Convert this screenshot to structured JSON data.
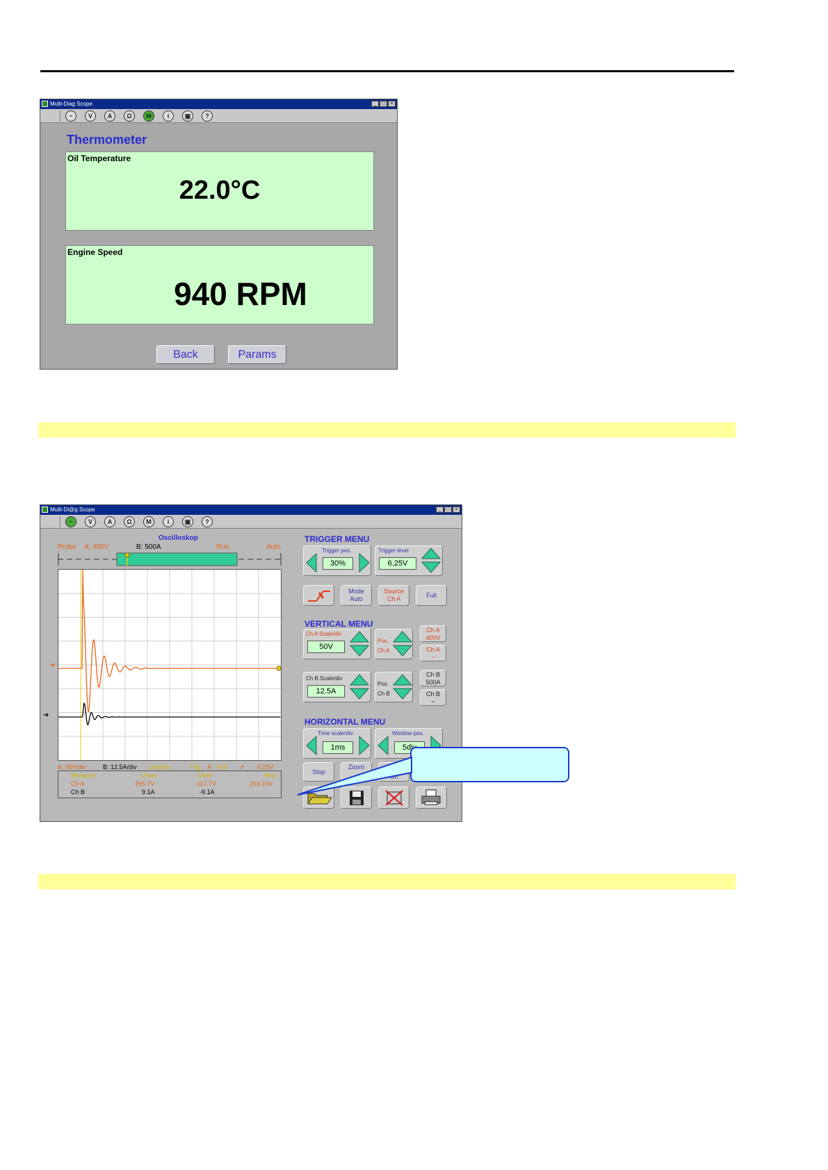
{
  "thermo_window": {
    "title": "Multi-Diag Scope",
    "heading": "Thermometer",
    "oil": {
      "label": "Oil Temperature",
      "value": "22.0°C"
    },
    "rpm": {
      "label": "Engine Speed",
      "value": "940 RPM"
    },
    "back_label": "Back",
    "params_label": "Params"
  },
  "scope_window": {
    "title": "Multi-Di@g Scope",
    "osc_label": "Oscilloskop",
    "probe_label": "Probe",
    "probe_a": "A: 400V",
    "probe_b": "B: 500A",
    "run_label": "Run",
    "auto_label": "Auto",
    "trigger_menu": "TRIGGER MENU",
    "trigger_pos_label": "Trigger pos.",
    "trigger_pos_value": "30%",
    "trigger_level_label": "Trigger level",
    "trigger_level_value": "6.25V",
    "mode_label": "Mode",
    "mode_value": "Auto",
    "source_label": "Source",
    "source_value": "Ch A",
    "full_label": "Full",
    "vertical_menu": "VERTICAL MENU",
    "cha_scale_label": "Ch A Scale/div",
    "cha_scale_value": "50V",
    "pos_label": "Pos.",
    "cha_label": "Ch A",
    "cha_400v": "400V",
    "cha_ac": "~",
    "chb_scale_label": "Ch B Scale/div",
    "chb_scale_value": "12.5A",
    "chb_label": "Ch B",
    "chb_500a": "500A",
    "chb_ac": "~",
    "horizontal_menu": "HORIZONTAL MENU",
    "time_scale_label": "Time scale/div",
    "time_scale_value": "1ms",
    "window_pos_label": "Window pos.",
    "window_pos_value": "5div",
    "stop_label": "Stop",
    "zoom_label": "Zoom",
    "on_label": "On",
    "status_a": "A: 50V/div",
    "status_b": "B: 12.5A/div",
    "status_time": "1ms/div",
    "status_trig": "Trig.",
    "status_trig_src": "A",
    "status_full": "Full",
    "status_trig_level": "6.25V",
    "meas_header": [
      "Measure",
      "Umax",
      "Umin",
      "freq"
    ],
    "meas_rows": [
      [
        "Ch A",
        "265.7V",
        "-117.7V",
        "203.1Hz"
      ],
      [
        "Ch B",
        "9.1A",
        "-9.1A",
        ""
      ]
    ]
  },
  "colors": {
    "accent_blue": "#2a2ad0",
    "panel_green": "#ccffcc",
    "trace_a": "#e8641a",
    "trace_b": "#000000",
    "trigger": "#e6d200",
    "highlight": "#ffff99",
    "callout": "#ccffff"
  },
  "icons": [
    "function-icon",
    "voltmeter-icon",
    "ammeter-icon",
    "ohmmeter-icon",
    "multimeter-icon",
    "info-icon",
    "print-preview-icon",
    "help-icon"
  ]
}
